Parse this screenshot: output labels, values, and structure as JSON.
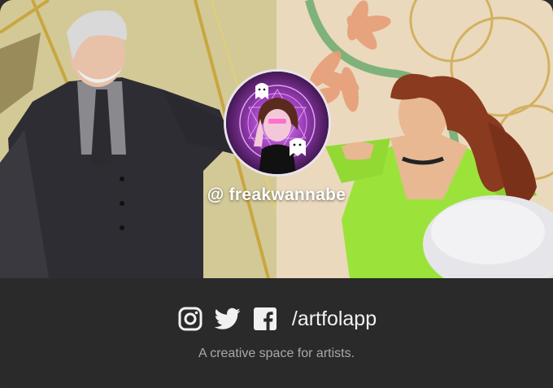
{
  "profile": {
    "username": "@ freakwannabe"
  },
  "footer": {
    "social_icons": [
      "instagram-icon",
      "twitter-icon",
      "facebook-icon"
    ],
    "handle": "/artfolapp",
    "tagline": "A creative space for artists."
  },
  "colors": {
    "footer_bg": "#2a2a2a",
    "tagline": "#a9a9a9",
    "dress_green": "#9be33a"
  }
}
